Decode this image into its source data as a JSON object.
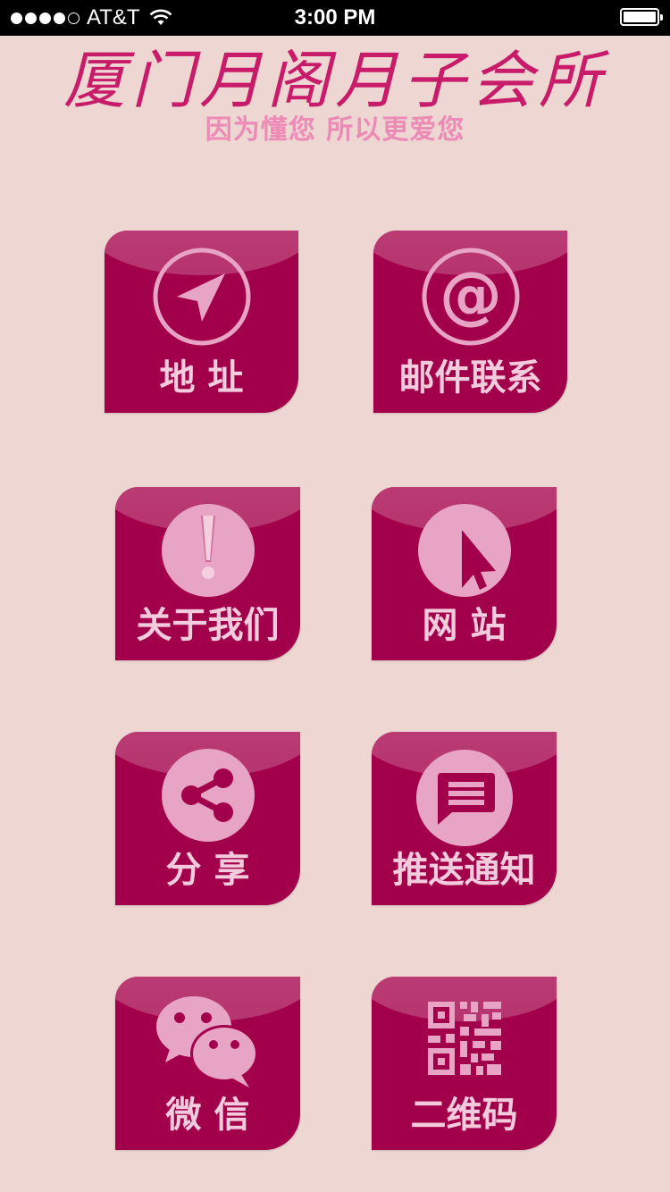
{
  "status_bar": {
    "carrier": "AT&T",
    "time": "3:00 PM"
  },
  "header": {
    "title": "厦门月阁月子会所",
    "subtitle": "因为懂您  所以更爱您"
  },
  "tiles": [
    {
      "label": "地 址",
      "icon": "navigation-arrow-icon"
    },
    {
      "label": "邮件联系",
      "icon": "at-sign-icon"
    },
    {
      "label": "关于我们",
      "icon": "exclamation-icon"
    },
    {
      "label": "网 站",
      "icon": "cursor-pointer-icon"
    },
    {
      "label": "分 享",
      "icon": "share-icon"
    },
    {
      "label": "推送通知",
      "icon": "chat-message-icon"
    },
    {
      "label": "微 信",
      "icon": "wechat-icon"
    },
    {
      "label": "二维码",
      "icon": "qr-code-icon"
    }
  ],
  "colors": {
    "background": "#eed6d3",
    "tile": "#a3004b",
    "title": "#c81c6a",
    "subtitle": "#ec8bb5",
    "tile_text": "#f2cbdc"
  }
}
